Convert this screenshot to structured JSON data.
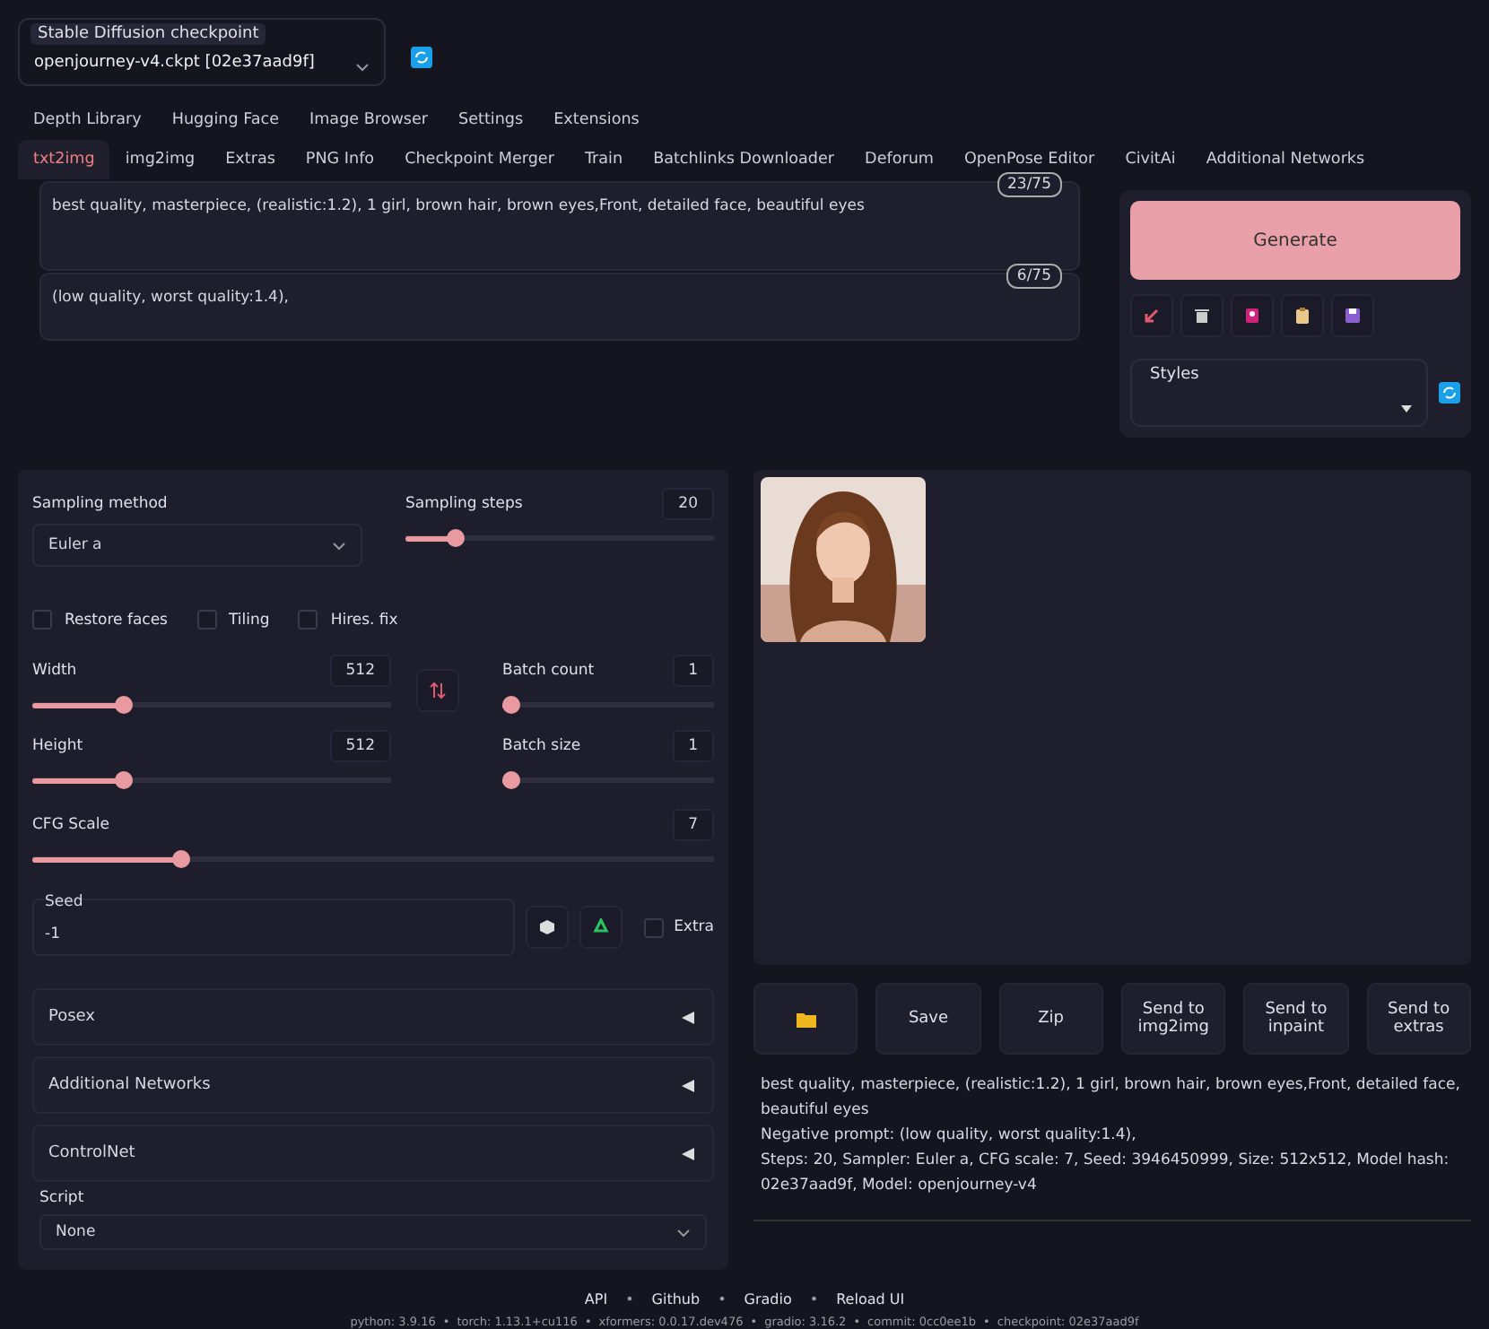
{
  "checkpoint": {
    "label": "Stable Diffusion checkpoint",
    "value": "openjourney-v4.ckpt [02e37aad9f]"
  },
  "tabs_top": [
    {
      "label": "Depth Library",
      "selected": false
    },
    {
      "label": "Hugging Face",
      "selected": false
    },
    {
      "label": "Image Browser",
      "selected": false
    },
    {
      "label": "Settings",
      "selected": false
    },
    {
      "label": "Extensions",
      "selected": false
    }
  ],
  "tabs": [
    {
      "label": "txt2img",
      "selected": true
    },
    {
      "label": "img2img",
      "selected": false
    },
    {
      "label": "Extras",
      "selected": false
    },
    {
      "label": "PNG Info",
      "selected": false
    },
    {
      "label": "Checkpoint Merger",
      "selected": false
    },
    {
      "label": "Train",
      "selected": false
    },
    {
      "label": "Batchlinks Downloader",
      "selected": false
    },
    {
      "label": "Deforum",
      "selected": false
    },
    {
      "label": "OpenPose Editor",
      "selected": false
    },
    {
      "label": "CivitAi",
      "selected": false
    },
    {
      "label": "Additional Networks",
      "selected": false
    }
  ],
  "prompt": {
    "value": "best quality, masterpiece, (realistic:1.2), 1 girl, brown hair, brown eyes,Front, detailed face, beautiful eyes",
    "tokens": "23/75"
  },
  "negative_prompt": {
    "value": "(low quality, worst quality:1.4),",
    "tokens": "6/75"
  },
  "generate": "Generate",
  "styles": {
    "label": "Styles"
  },
  "sampling_method": {
    "label": "Sampling method",
    "value": "Euler a"
  },
  "sampling_steps": {
    "label": "Sampling steps",
    "value": "20",
    "level": 0.14
  },
  "checkboxes": [
    {
      "label": "Restore faces",
      "checked": false
    },
    {
      "label": "Tiling",
      "checked": false
    },
    {
      "label": "Hires. fix",
      "checked": false
    }
  ],
  "width": {
    "label": "Width",
    "value": "512",
    "level": 0.24
  },
  "height": {
    "label": "Height",
    "value": "512",
    "level": 0.24
  },
  "batch_count": {
    "label": "Batch count",
    "value": "1",
    "level": 0
  },
  "batch_size": {
    "label": "Batch size",
    "value": "1",
    "level": 0
  },
  "cfg_scale": {
    "label": "CFG Scale",
    "value": "7",
    "level": 0.21
  },
  "seed": {
    "label": "Seed",
    "value": "-1",
    "extra": {
      "label": "Extra",
      "checked": false
    }
  },
  "accordions": [
    {
      "label": "Posex",
      "expanded": false
    },
    {
      "label": "Additional Networks",
      "expanded": false
    },
    {
      "label": "ControlNet",
      "expanded": false
    }
  ],
  "script": {
    "label": "Script",
    "value": "None"
  },
  "output": {
    "image": {
      "kind": "picture"
    },
    "buttons": [
      "Save",
      "Zip",
      "Send to img2img",
      "Send to inpaint",
      "Send to extras"
    ],
    "info": [
      "best quality, masterpiece, (realistic:1.2), 1 girl, brown hair, brown eyes,Front, detailed face, beautiful eyes",
      "Negative prompt: (low quality, worst quality:1.4),",
      "Steps: 20, Sampler: Euler a, CFG scale: 7, Seed: 3946450999, Size: 512x512, Model hash: 02e37aad9f, Model: openjourney-v4"
    ]
  },
  "footer": {
    "separator": "•",
    "links": [
      "API",
      "Github",
      "Gradio",
      "Reload UI"
    ],
    "versions": [
      "python: 3.9.16",
      "torch: 1.13.1+cu116",
      "xformers: 0.0.17.dev476",
      "gradio: 3.16.2",
      "commit: 0cc0ee1b",
      "checkpoint: 02e37aad9f"
    ]
  }
}
